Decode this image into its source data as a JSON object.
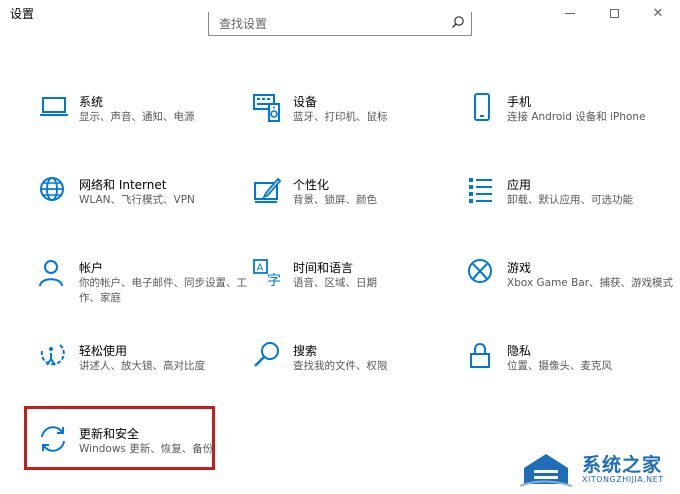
{
  "window": {
    "title": "设置"
  },
  "search": {
    "placeholder": "查找设置"
  },
  "tiles": [
    {
      "title": "系统",
      "desc": "显示、声音、通知、电源",
      "icon": "laptop-icon"
    },
    {
      "title": "设备",
      "desc": "蓝牙、打印机、鼠标",
      "icon": "keyboard-speaker-icon"
    },
    {
      "title": "手机",
      "desc": "连接 Android 设备和 iPhone",
      "icon": "phone-icon"
    },
    {
      "title": "网络和 Internet",
      "desc": "WLAN、飞行模式、VPN",
      "icon": "globe-icon"
    },
    {
      "title": "个性化",
      "desc": "背景、锁屏、颜色",
      "icon": "paint-brush-icon"
    },
    {
      "title": "应用",
      "desc": "卸载、默认应用、可选功能",
      "icon": "app-list-icon"
    },
    {
      "title": "帐户",
      "desc": "你的帐户、电子邮件、同步设置、工作、家庭",
      "icon": "person-icon"
    },
    {
      "title": "时间和语言",
      "desc": "语音、区域、日期",
      "icon": "time-language-icon"
    },
    {
      "title": "游戏",
      "desc": "Xbox Game Bar、捕获、游戏模式",
      "icon": "xbox-icon"
    },
    {
      "title": "轻松使用",
      "desc": "讲述人、放大镜、高对比度",
      "icon": "ease-of-access-icon"
    },
    {
      "title": "搜索",
      "desc": "查找我的文件、权限",
      "icon": "magnifier-icon"
    },
    {
      "title": "隐私",
      "desc": "位置、摄像头、麦克风",
      "icon": "lock-icon"
    },
    {
      "title": "更新和安全",
      "desc": "Windows 更新、恢复、备份",
      "icon": "sync-arrows-icon"
    }
  ],
  "watermark": {
    "title": "系统之家",
    "url": "XITONGZHIJIA.NET"
  },
  "colors": {
    "accent": "#0078d7",
    "highlight": "#c11e1e",
    "watermark": "#1f6db8"
  }
}
